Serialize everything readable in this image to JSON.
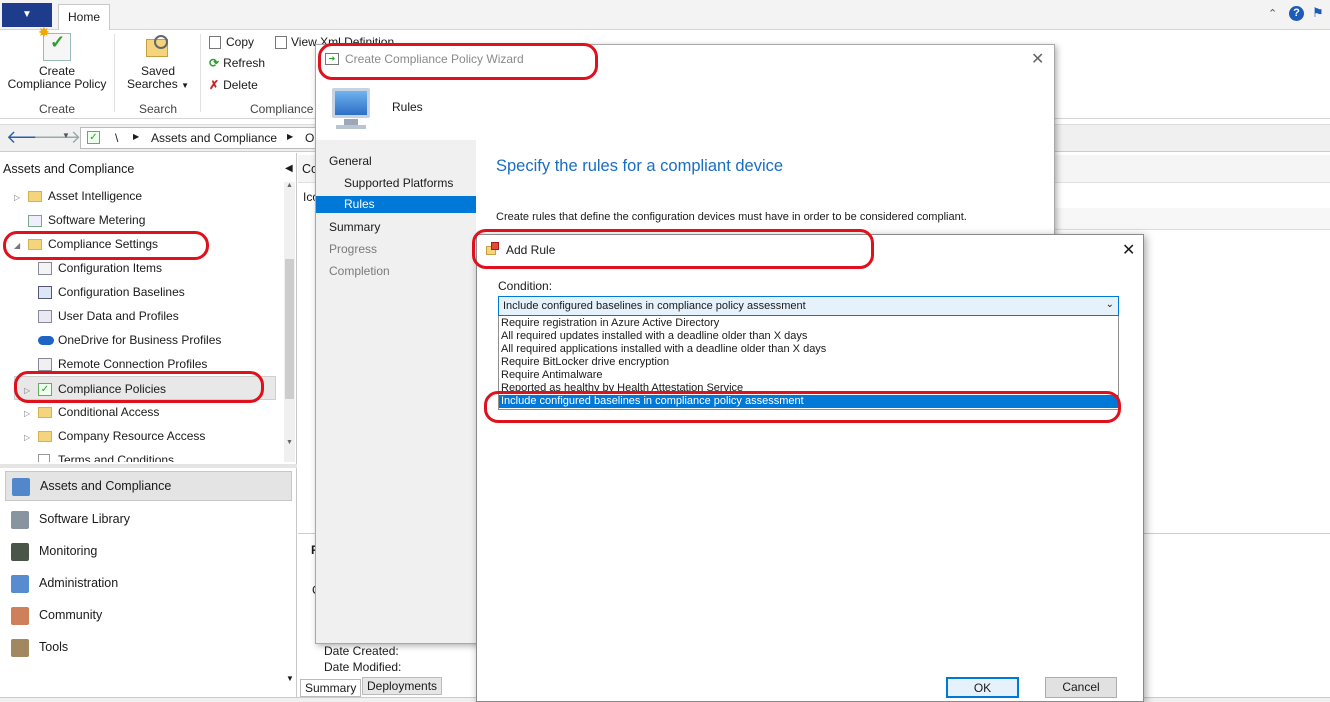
{
  "ribbon": {
    "app_menu_icon": "chevron-down-icon",
    "home_tab": "Home",
    "create_policy_label_1": "Create",
    "create_policy_label_2": "Compliance Policy",
    "create_group": "Create",
    "saved_searches_label_1": "Saved",
    "saved_searches_label_2": "Searches",
    "search_group": "Search",
    "copy": "Copy",
    "refresh": "Refresh",
    "delete": "Delete",
    "view_xml": "View Xml Definition",
    "compliance_group": "Compliance"
  },
  "address": {
    "root": "\\",
    "segment1": "Assets and Compliance",
    "segment2_partial": "O"
  },
  "nav": {
    "title": "Assets and Compliance",
    "tree": [
      {
        "label": "Asset Intelligence",
        "icon": "folder-icon",
        "indent": 1
      },
      {
        "label": "Software Metering",
        "icon": "metering-icon",
        "indent": 1
      },
      {
        "label": "Compliance Settings",
        "icon": "folder-icon",
        "indent": 1,
        "expanded": true
      },
      {
        "label": "Configuration Items",
        "icon": "config-item-icon",
        "indent": 2
      },
      {
        "label": "Configuration Baselines",
        "icon": "baseline-icon",
        "indent": 2
      },
      {
        "label": "User Data and Profiles",
        "icon": "user-data-icon",
        "indent": 2
      },
      {
        "label": "OneDrive for Business Profiles",
        "icon": "cloud-icon",
        "indent": 2
      },
      {
        "label": "Remote Connection Profiles",
        "icon": "remote-icon",
        "indent": 2
      },
      {
        "label": "Compliance Policies",
        "icon": "checkmark-icon",
        "indent": 2,
        "selected": true
      },
      {
        "label": "Conditional Access",
        "icon": "folder-icon",
        "indent": 2
      },
      {
        "label": "Company Resource Access",
        "icon": "folder-icon",
        "indent": 2
      },
      {
        "label": "Terms and Conditions",
        "icon": "document-icon",
        "indent": 2
      }
    ],
    "workspaces": [
      {
        "label": "Assets and Compliance",
        "icon": "assets-icon",
        "active": true
      },
      {
        "label": "Software Library",
        "icon": "library-icon"
      },
      {
        "label": "Monitoring",
        "icon": "monitor-icon"
      },
      {
        "label": "Administration",
        "icon": "admin-icon"
      },
      {
        "label": "Community",
        "icon": "community-icon"
      },
      {
        "label": "Tools",
        "icon": "tools-icon"
      }
    ]
  },
  "background": {
    "col_co": "Co",
    "col_ico": "Ico",
    "date_created": "Date Created:",
    "date_modified": "Date Modified:",
    "tab_summary": "Summary",
    "tab_deployments": "Deployments",
    "r_letter": "R",
    "c_letter": "C"
  },
  "wizard": {
    "title": "Create Compliance Policy Wizard",
    "page_name": "Rules",
    "heading": "Specify the rules for a compliant device",
    "description": "Create rules that define the configuration devices must have in order to be considered compliant.",
    "steps": [
      {
        "label": "General",
        "indent": 0,
        "state": "done"
      },
      {
        "label": "Supported Platforms",
        "indent": 1,
        "state": "done"
      },
      {
        "label": "Rules",
        "indent": 1,
        "state": "current"
      },
      {
        "label": "Summary",
        "indent": 0,
        "state": "done"
      },
      {
        "label": "Progress",
        "indent": 0,
        "state": "pending"
      },
      {
        "label": "Completion",
        "indent": 0,
        "state": "pending"
      }
    ]
  },
  "add_rule": {
    "title": "Add Rule",
    "condition_label": "Condition:",
    "selected_value": "Include configured baselines in compliance policy assessment",
    "options": [
      "Require registration in Azure Active Directory",
      "All required updates installed with a deadline older than X days",
      "All required applications installed with a deadline older than X days",
      "Require BitLocker drive encryption",
      "Require Antimalware",
      "Reported as healthy by Health Attestation Service",
      "Include configured baselines in compliance policy assessment"
    ],
    "highlighted_index": 6,
    "ok": "OK",
    "cancel": "Cancel"
  },
  "colors": {
    "accent": "#0078d7",
    "heading_blue": "#1a6cc4",
    "annotation_red": "#e0101c"
  }
}
